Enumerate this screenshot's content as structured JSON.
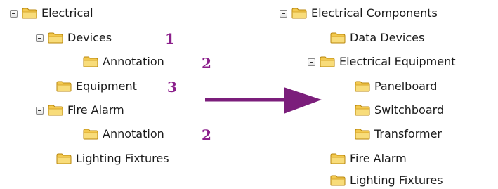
{
  "left_tree": {
    "root": "Electrical",
    "devices": "Devices",
    "devices_annotation": "Annotation",
    "equipment": "Equipment",
    "fire_alarm": "Fire Alarm",
    "fire_alarm_annotation": "Annotation",
    "lighting_fixtures": "Lighting Fixtures"
  },
  "markers": {
    "devices": "1",
    "devices_annotation": "2",
    "equipment": "3",
    "fire_alarm_annotation": "2"
  },
  "right_tree": {
    "root": "Electrical Components",
    "data_devices": "Data Devices",
    "electrical_equipment": "Electrical Equipment",
    "panelboard": "Panelboard",
    "switchboard": "Switchboard",
    "transformer": "Transformer",
    "fire_alarm": "Fire Alarm",
    "lighting_fixtures": "Lighting Fixtures"
  },
  "colors": {
    "arrow": "#7b1e7b",
    "marker": "#8b1f8b",
    "folder_fill": "#f3c94f",
    "folder_outline": "#b8860b"
  }
}
